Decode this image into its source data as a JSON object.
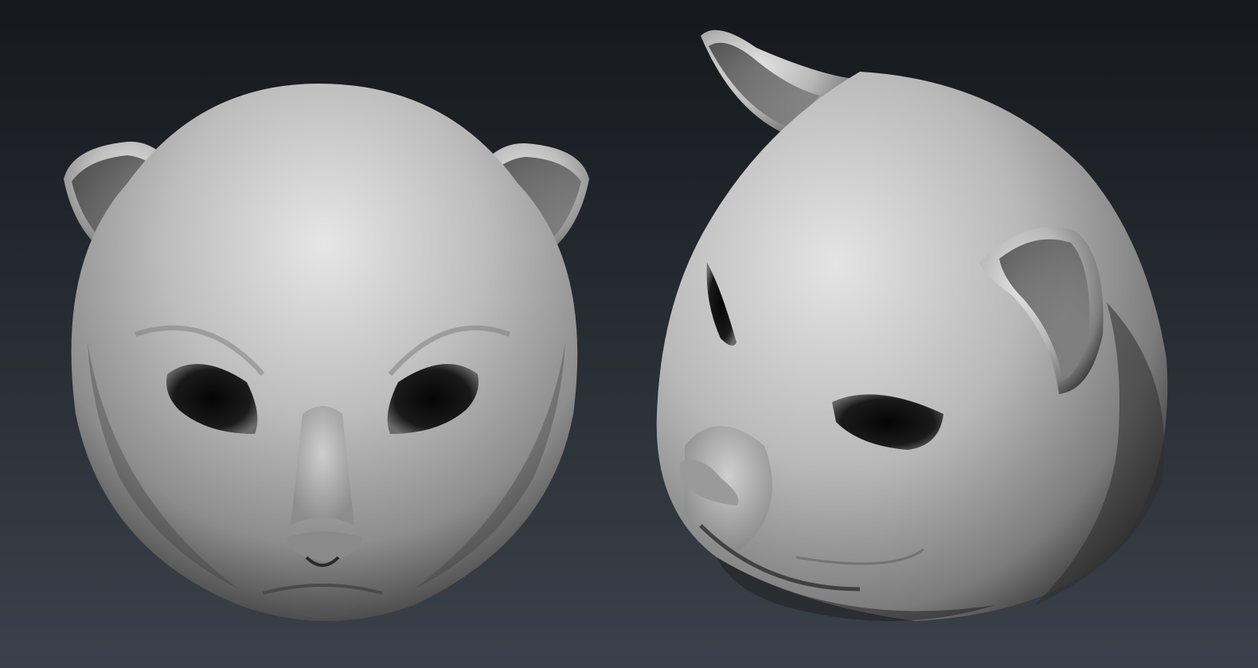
{
  "scene": {
    "subjects": [
      {
        "name": "cat-head-front-view",
        "material": "matte-gray-clay"
      },
      {
        "name": "cat-head-three-quarter-view",
        "material": "matte-gray-clay"
      }
    ],
    "colors": {
      "background_top": "#15181c",
      "background_bottom": "#3b414a",
      "clay_light": "#e6e6e6",
      "clay_mid": "#9a9a9a",
      "clay_dark": "#2a2a2a"
    }
  }
}
